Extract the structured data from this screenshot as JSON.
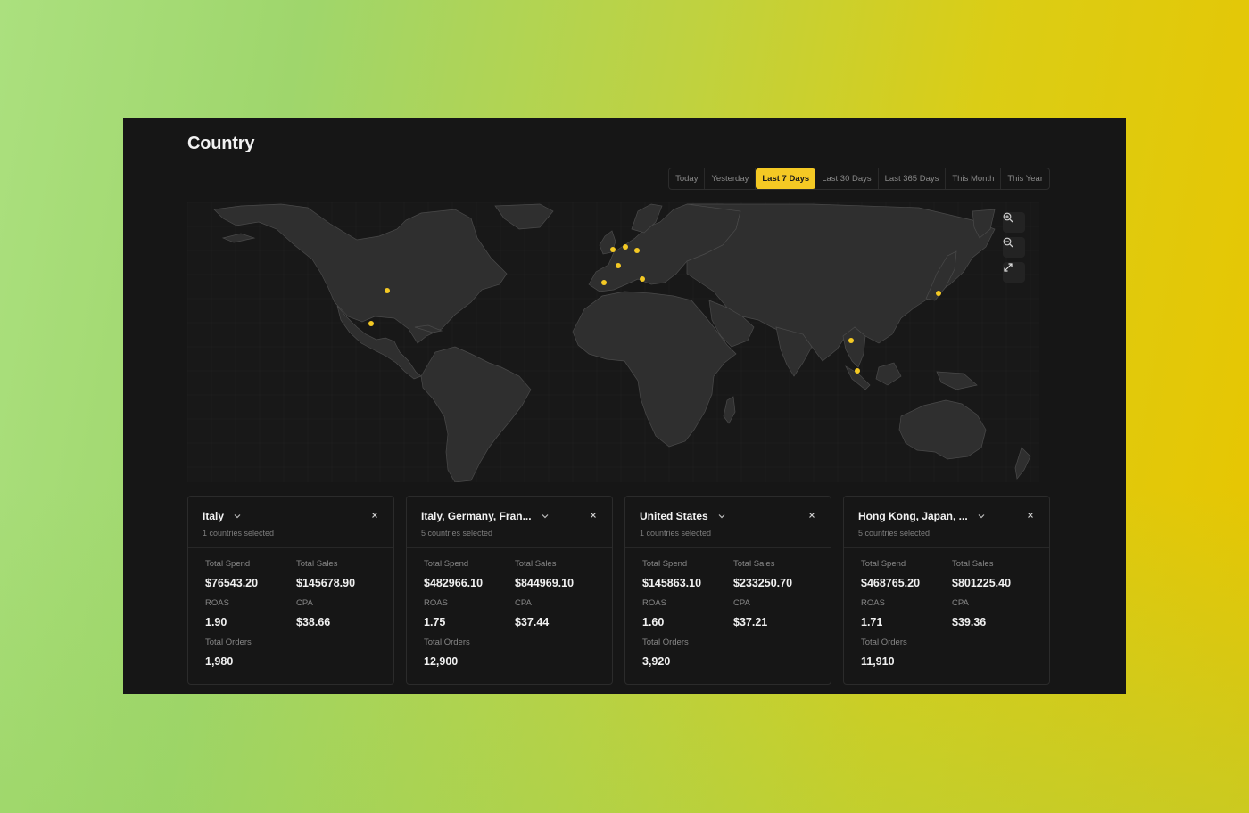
{
  "page": {
    "title": "Country"
  },
  "date_range": {
    "options": [
      "Today",
      "Yesterday",
      "Last 7 Days",
      "Last 30 Days",
      "Last 365 Days",
      "This Month",
      "This Year"
    ],
    "selected": "Last 7 Days"
  },
  "map": {
    "controls": {
      "zoom_in": "zoom-in-icon",
      "zoom_out": "zoom-out-icon",
      "fullscreen": "expand-icon"
    },
    "marker_color": "#f4c924",
    "markers": [
      {
        "country": "United States"
      },
      {
        "country": "Mexico"
      },
      {
        "country": "United Kingdom"
      },
      {
        "country": "Netherlands"
      },
      {
        "country": "Germany"
      },
      {
        "country": "France"
      },
      {
        "country": "Spain"
      },
      {
        "country": "Italy"
      },
      {
        "country": "Japan"
      },
      {
        "country": "Thailand"
      },
      {
        "country": "Singapore"
      }
    ]
  },
  "cards": [
    {
      "title": "Italy",
      "subtitle": "1 countries selected",
      "total_spend_label": "Total Spend",
      "total_spend": "$76543.20",
      "total_sales_label": "Total Sales",
      "total_sales": "$145678.90",
      "roas_label": "ROAS",
      "roas": "1.90",
      "cpa_label": "CPA",
      "cpa": "$38.66",
      "total_orders_label": "Total Orders",
      "total_orders": "1,980"
    },
    {
      "title": "Italy, Germany, Fran...",
      "subtitle": "5 countries selected",
      "total_spend_label": "Total Spend",
      "total_spend": "$482966.10",
      "total_sales_label": "Total Sales",
      "total_sales": "$844969.10",
      "roas_label": "ROAS",
      "roas": "1.75",
      "cpa_label": "CPA",
      "cpa": "$37.44",
      "total_orders_label": "Total Orders",
      "total_orders": "12,900"
    },
    {
      "title": "United States",
      "subtitle": "1 countries selected",
      "total_spend_label": "Total Spend",
      "total_spend": "$145863.10",
      "total_sales_label": "Total Sales",
      "total_sales": "$233250.70",
      "roas_label": "ROAS",
      "roas": "1.60",
      "cpa_label": "CPA",
      "cpa": "$37.21",
      "total_orders_label": "Total Orders",
      "total_orders": "3,920"
    },
    {
      "title": "Hong Kong, Japan, ...",
      "subtitle": "5 countries selected",
      "total_spend_label": "Total Spend",
      "total_spend": "$468765.20",
      "total_sales_label": "Total Sales",
      "total_sales": "$801225.40",
      "roas_label": "ROAS",
      "roas": "1.71",
      "cpa_label": "CPA",
      "cpa": "$39.36",
      "total_orders_label": "Total Orders",
      "total_orders": "11,910"
    }
  ]
}
